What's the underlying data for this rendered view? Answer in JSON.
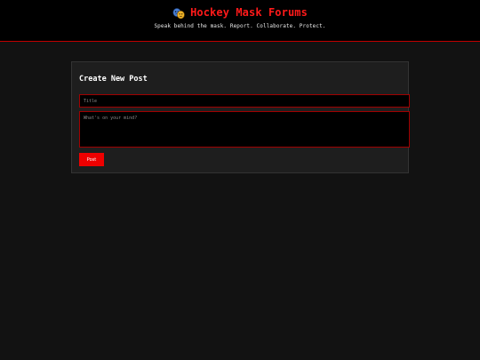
{
  "header": {
    "logo_icon": "theater-masks-icon",
    "title": "Hockey Mask Forums",
    "tagline": "Speak behind the mask. Report. Collaborate. Protect."
  },
  "composer": {
    "heading": "Create New Post",
    "title_placeholder": "Title",
    "body_placeholder": "What's on your mind?",
    "post_label": "Post"
  },
  "colors": {
    "accent": "#ee0000",
    "header_bg": "#000000",
    "page_bg": "#121212",
    "card_bg": "#1e1e1e"
  }
}
